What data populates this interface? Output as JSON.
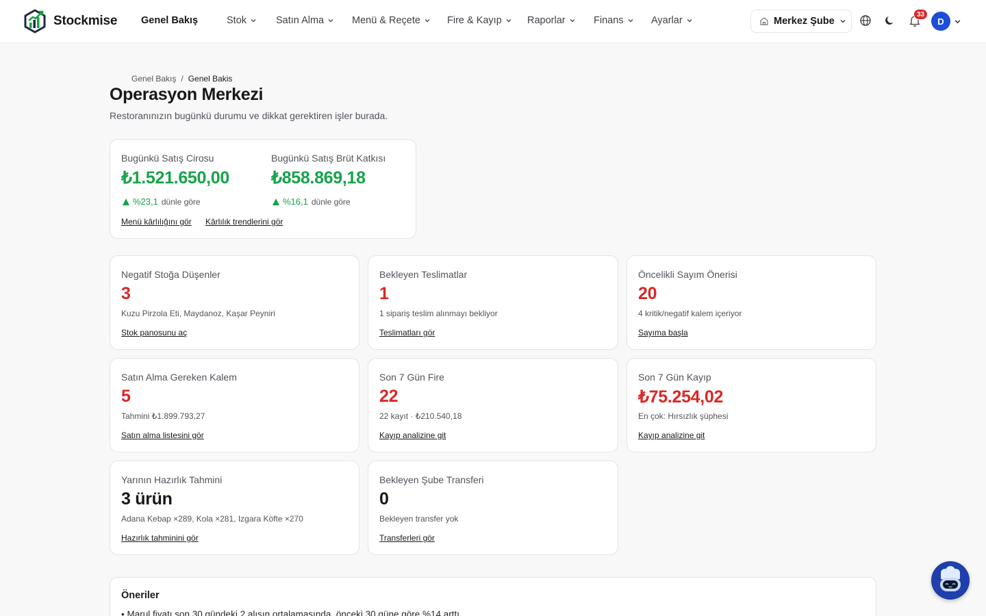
{
  "header": {
    "brand": "Stockmise",
    "nav": [
      {
        "label": "Genel Bakış"
      },
      {
        "label": "Stok"
      },
      {
        "label": "Satın Alma"
      },
      {
        "label": "Menü & Reçete"
      },
      {
        "label": "Fire & Kayıp"
      },
      {
        "label": "Raporlar"
      },
      {
        "label": "Finans"
      },
      {
        "label": "Ayarlar"
      }
    ],
    "branch": "Merkez Şube",
    "notification_count": "33",
    "avatar_initial": "D"
  },
  "breadcrumb": {
    "root": "Genel Bakış",
    "separator": "/",
    "current": "Genel Bakis"
  },
  "page": {
    "title": "Operasyon Merkezi",
    "subtitle": "Restoranınızın bugünkü durumu ve dikkat gerektiren işler burada."
  },
  "sales": {
    "revenue_label": "Bugünkü Satış Cirosu",
    "revenue_value": "₺1.521.650,00",
    "revenue_change": "%23,1",
    "revenue_change_suffix": "dünle göre",
    "margin_label": "Bugünkü Satış Brüt Katkısı",
    "margin_value": "₺858.869,18",
    "margin_change": "%16,1",
    "margin_change_suffix": "dünle göre",
    "link_menu": "Menü kârlılığını gör",
    "link_trend": "Kârlılık trendlerini gör"
  },
  "cards": [
    {
      "title": "Negatif Stoğa Düşenler",
      "value": "3",
      "detail": "Kuzu Pirzola Eti, Maydanoz, Kaşar Peyniri",
      "link": "Stok panosunu aç"
    },
    {
      "title": "Bekleyen Teslimatlar",
      "value": "1",
      "detail": "1 sipariş teslim alınmayı bekliyor",
      "link": "Teslimatları gör"
    },
    {
      "title": "Öncelikli Sayım Önerisi",
      "value": "20",
      "detail": "4 kritik/negatif kalem içeriyor",
      "link": "Sayıma başla"
    },
    {
      "title": "Satın Alma Gereken Kalem",
      "value": "5",
      "detail": "Tahmini ₺1.899.793,27",
      "link": "Satın alma listesini gör"
    },
    {
      "title": "Son 7 Gün Fire",
      "value": "22",
      "detail": "22 kayıt · ₺210.540,18",
      "link": "Kayıp analizine git"
    },
    {
      "title": "Son 7 Gün Kayıp",
      "value": "₺75.254,02",
      "detail": "En çok: Hırsızlık şüphesi",
      "link": "Kayıp analizine git"
    },
    {
      "title": "Yarının Hazırlık Tahmini",
      "value": "3 ürün",
      "detail": "Adana Kebap ×289, Kola ×281, Izgara Köfte ×270",
      "link": "Hazırlık tahminini gör"
    },
    {
      "title": "Bekleyen Şube Transferi",
      "value": "0",
      "detail": "Bekleyen transfer yok",
      "link": "Transferleri gör"
    }
  ],
  "suggestions": {
    "title": "Öneriler",
    "items": [
      "• Marul fiyatı son 30 gündeki 2 alışın ortalamasında, önceki 30 güne göre %14 arttı."
    ]
  },
  "colors": {
    "positive": "#16a34a",
    "negative": "#dc2626",
    "brand_blue": "#1d4ed8",
    "badge": "#dc2626"
  },
  "icons": [
    "logo-icon",
    "chevron-down-icon",
    "store-icon",
    "globe-icon",
    "moon-icon",
    "bell-icon",
    "assistant-icon"
  ]
}
